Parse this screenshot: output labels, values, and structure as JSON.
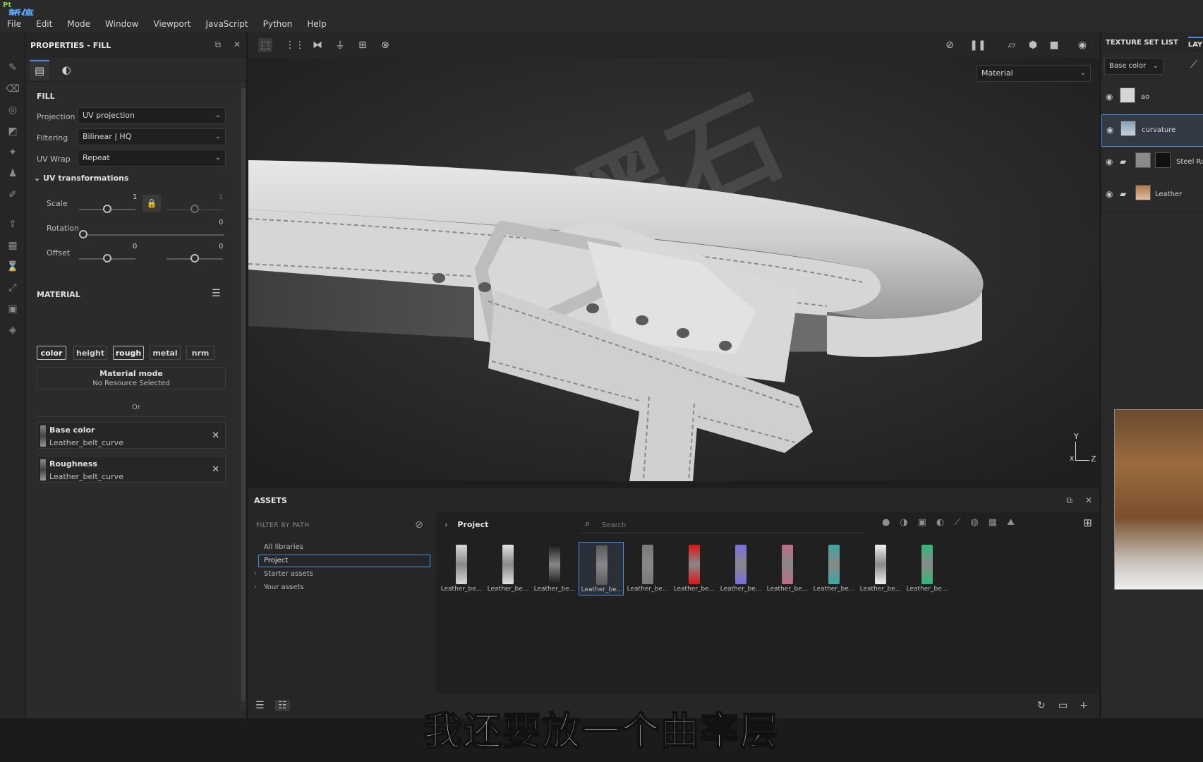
{
  "app": {
    "logo": "Pt",
    "overlay_label": "暂停"
  },
  "menu": [
    "File",
    "Edit",
    "Mode",
    "Window",
    "Viewport",
    "JavaScript",
    "Python",
    "Help"
  ],
  "properties": {
    "title": "PROPERTIES - FILL",
    "fill_title": "FILL",
    "projection": {
      "label": "Projection",
      "value": "UV projection"
    },
    "filtering": {
      "label": "Filtering",
      "value": "Bilinear | HQ"
    },
    "uvwrap": {
      "label": "UV Wrap",
      "value": "Repeat"
    },
    "uv_transform_title": "UV transformations",
    "scale": {
      "label": "Scale",
      "value1": "1",
      "value2": "1",
      "position": 0.5
    },
    "rotation": {
      "label": "Rotation",
      "value": "0",
      "position": 0.0
    },
    "offset": {
      "label": "Offset",
      "value1": "0",
      "value2": "0",
      "position": 0.5
    },
    "material_title": "MATERIAL",
    "channels": [
      "color",
      "height",
      "rough",
      "metal",
      "nrm"
    ],
    "channels_on": [
      "color",
      "rough"
    ],
    "material_mode": {
      "title": "Material mode",
      "subtitle": "No Resource Selected"
    },
    "or_text": "Or",
    "resources": [
      {
        "name": "Base color",
        "file": "Leather_belt_curve"
      },
      {
        "name": "Roughness",
        "file": "Leather_belt_curve"
      }
    ]
  },
  "viewport": {
    "material_dropdown": "Material",
    "axis_y": "Y",
    "axis_z": "Z",
    "axis_x": "X"
  },
  "assets": {
    "title": "ASSETS",
    "filter_title": "FILTER BY PATH",
    "libraries": [
      "All libraries",
      "Project",
      "Starter assets",
      "Your assets"
    ],
    "selected_library": "Project",
    "breadcrumb": "Project",
    "search_placeholder": "Search",
    "items": [
      {
        "label": "Leather_be...",
        "color": "#d8d8d8"
      },
      {
        "label": "Leather_be...",
        "color": "#e0e0e0"
      },
      {
        "label": "Leather_be...",
        "color": "#1a1a1a"
      },
      {
        "label": "Leather_be...",
        "color": "#5a5a5a"
      },
      {
        "label": "Leather_be...",
        "color": "#7a7a7a"
      },
      {
        "label": "Leather_be...",
        "color": "#e01414"
      },
      {
        "label": "Leather_be...",
        "color": "#7a6ee0"
      },
      {
        "label": "Leather_be...",
        "color": "#c06a8a"
      },
      {
        "label": "Leather_be...",
        "color": "#3aa8a0"
      },
      {
        "label": "Leather_be...",
        "color": "#f0f0f0"
      },
      {
        "label": "Leather_be...",
        "color": "#2fb87a"
      }
    ],
    "selected_index": 3
  },
  "right_panel": {
    "tabs": [
      "TEXTURE SET LIST",
      "LAYER"
    ],
    "channel_dropdown": "Base color",
    "layers": [
      {
        "name": "ao",
        "selected": false,
        "folder": false
      },
      {
        "name": "curvature",
        "selected": true,
        "folder": false
      },
      {
        "name": "Steel Ru",
        "selected": false,
        "folder": true
      },
      {
        "name": "Leather",
        "selected": false,
        "folder": true
      }
    ]
  },
  "subtitle": "我还要放一个曲率层"
}
